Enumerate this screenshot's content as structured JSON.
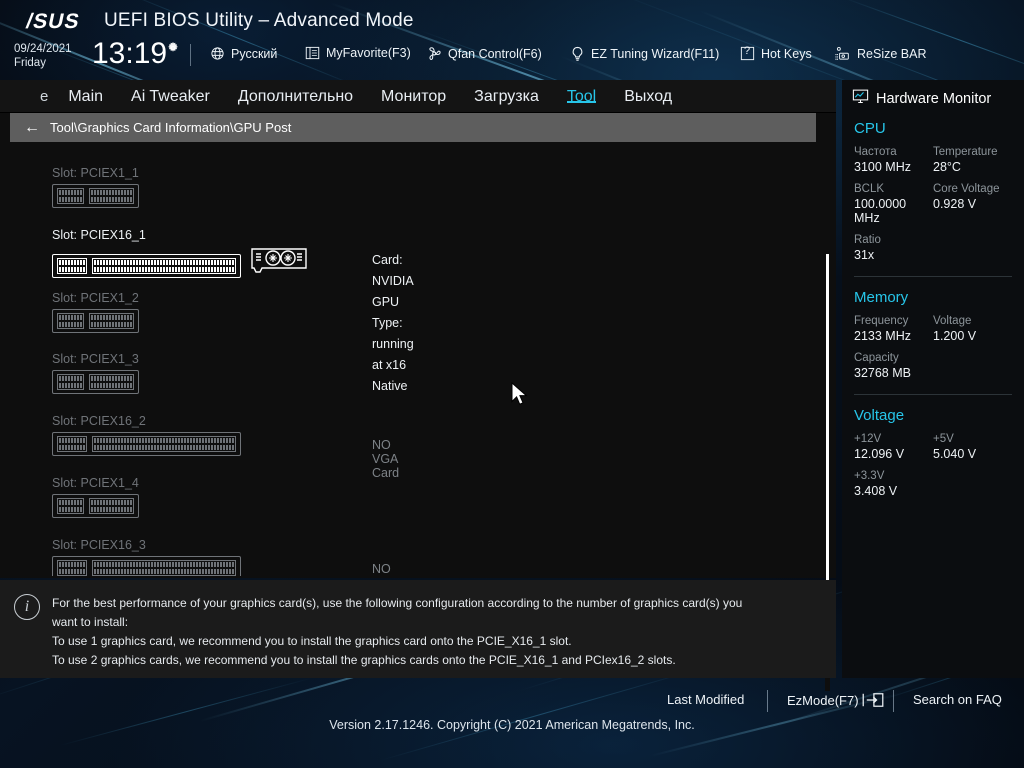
{
  "header": {
    "brand": "/SUS",
    "title": "UEFI BIOS Utility – Advanced Mode",
    "date": "09/24/2021",
    "weekday": "Friday",
    "time": "13:19",
    "gear_icon": "gear-icon",
    "items": [
      {
        "icon": "globe-icon",
        "label": "Русский"
      },
      {
        "icon": "list-icon",
        "label": "MyFavorite(F3)"
      },
      {
        "icon": "fan-icon",
        "label": "Qfan Control(F6)"
      },
      {
        "icon": "bulb-icon",
        "label": "EZ Tuning Wizard(F11)"
      },
      {
        "icon": "help-icon",
        "label": "Hot Keys"
      },
      {
        "icon": "resizebar-icon",
        "label": "ReSize BAR"
      }
    ]
  },
  "menu": {
    "clipped_item": "е",
    "items": [
      {
        "label": "Main",
        "active": false
      },
      {
        "label": "Ai Tweaker",
        "active": false
      },
      {
        "label": "Дополнительно",
        "active": false
      },
      {
        "label": "Монитор",
        "active": false
      },
      {
        "label": "Загрузка",
        "active": false
      },
      {
        "label": "Tool",
        "active": true
      },
      {
        "label": "Выход",
        "active": false
      }
    ],
    "accent_color": "#27c6ea"
  },
  "breadcrumb": {
    "back_icon": "arrow-left-icon",
    "path": "Tool\\Graphics Card Information\\GPU Post"
  },
  "slots": [
    {
      "name": "Slot: PCIEX1_1",
      "type": "x1",
      "highlighted": false,
      "card": null,
      "status": null
    },
    {
      "name": "Slot: PCIEX16_1",
      "type": "x16",
      "highlighted": true,
      "card": "Card: NVIDIA GPU",
      "card_type": "Type: running at x16 Native",
      "status": null
    },
    {
      "name": "Slot: PCIEX1_2",
      "type": "x1",
      "highlighted": false,
      "card": null,
      "status": null
    },
    {
      "name": "Slot: PCIEX1_3",
      "type": "x1",
      "highlighted": false,
      "card": null,
      "status": null
    },
    {
      "name": "Slot: PCIEX16_2",
      "type": "x16",
      "highlighted": false,
      "card": null,
      "status": "NO VGA Card"
    },
    {
      "name": "Slot: PCIEX1_4",
      "type": "x1",
      "highlighted": false,
      "card": null,
      "status": null
    },
    {
      "name": "Slot: PCIEX16_3",
      "type": "x16",
      "highlighted": false,
      "card": null,
      "status": "NO VGA Card"
    }
  ],
  "info": {
    "icon": "info-icon",
    "lines": [
      "For the best performance of your graphics card(s), use the following configuration according to the number of graphics card(s) you",
      "want to install:",
      "To use 1 graphics card, we recommend you to install  the graphics card onto the PCIE_X16_1 slot.",
      "To use 2 graphics cards, we recommend you to install the graphics cards onto the PCIE_X16_1 and PCIex16_2 slots."
    ]
  },
  "hardware_monitor": {
    "title": "Hardware Monitor",
    "title_icon": "monitor-icon",
    "accent_color": "#27c6ea",
    "sections": [
      {
        "name": "CPU",
        "rows": [
          [
            {
              "label": "Частота",
              "value": "3100 MHz"
            },
            {
              "label": "Temperature",
              "value": "28°C"
            }
          ],
          [
            {
              "label": "BCLK",
              "value": "100.0000 MHz"
            },
            {
              "label": "Core Voltage",
              "value": "0.928 V"
            }
          ],
          [
            {
              "label": "Ratio",
              "value": "31x"
            }
          ]
        ]
      },
      {
        "name": "Memory",
        "rows": [
          [
            {
              "label": "Frequency",
              "value": "2133 MHz"
            },
            {
              "label": "Voltage",
              "value": "1.200 V"
            }
          ],
          [
            {
              "label": "Capacity",
              "value": "32768 MB"
            }
          ]
        ]
      },
      {
        "name": "Voltage",
        "rows": [
          [
            {
              "label": "+12V",
              "value": "12.096 V"
            },
            {
              "label": "+5V",
              "value": "5.040 V"
            }
          ],
          [
            {
              "label": "+3.3V",
              "value": "3.408 V"
            }
          ]
        ]
      }
    ]
  },
  "footer": {
    "last_modified": "Last Modified",
    "ezmode": "EzMode(F7)",
    "ezmode_icon": "exit-arrow-icon",
    "search_faq": "Search on FAQ",
    "version": "Version 2.17.1246. Copyright (C) 2021 American Megatrends, Inc."
  }
}
